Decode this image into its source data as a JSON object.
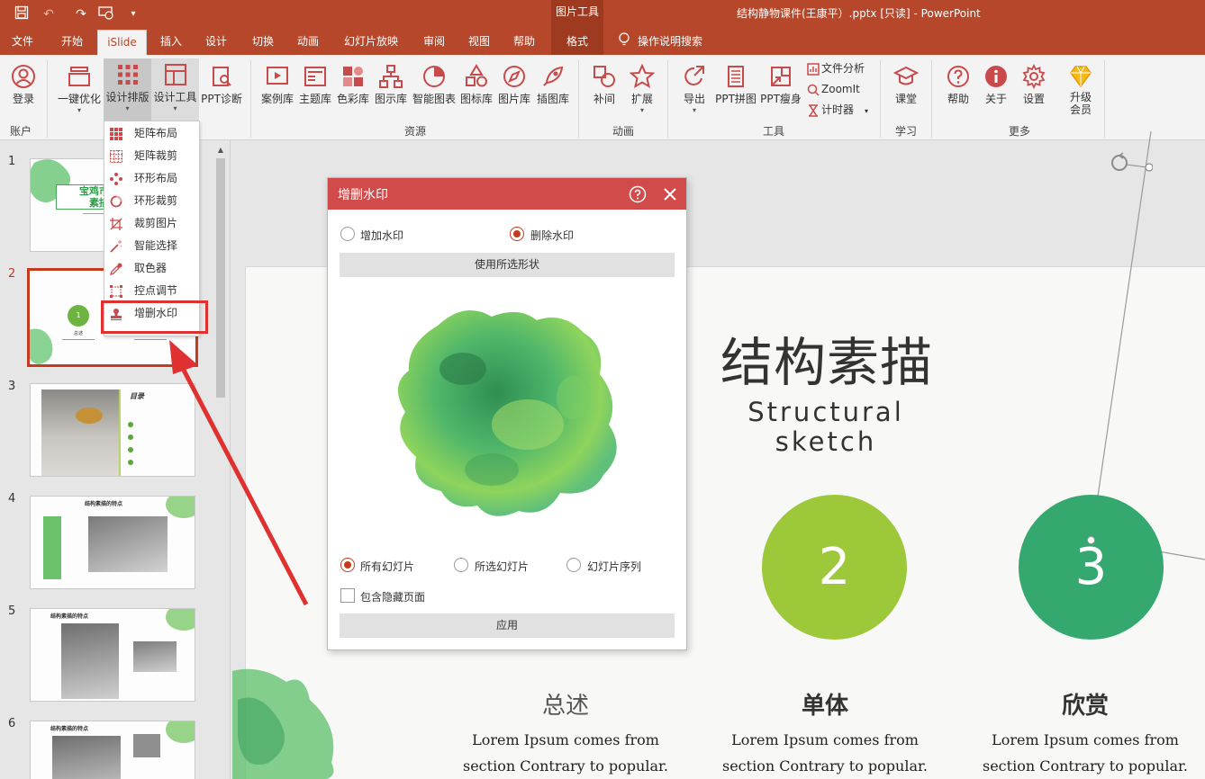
{
  "titlebar": {
    "context_tool_label": "图片工具",
    "window_title": "结构静物课件(王康平）.pptx [只读]  -  PowerPoint"
  },
  "tabs": [
    {
      "label": "文件"
    },
    {
      "label": "开始"
    },
    {
      "label": "iSlide"
    },
    {
      "label": "插入"
    },
    {
      "label": "设计"
    },
    {
      "label": "切换"
    },
    {
      "label": "动画"
    },
    {
      "label": "幻灯片放映"
    },
    {
      "label": "审阅"
    },
    {
      "label": "视图"
    },
    {
      "label": "帮助"
    },
    {
      "label": "格式"
    }
  ],
  "tell_me": "操作说明搜索",
  "ribbon": {
    "login": "登录",
    "optimize": "一键优化",
    "design_layout": "设计排版",
    "design_tools": "设计工具",
    "ppt_diagnose": "PPT诊断",
    "case_lib": "案例库",
    "theme_lib": "主题库",
    "color_lib": "色彩库",
    "diagram_lib": "图示库",
    "smart_chart": "智能图表",
    "icon_lib": "图标库",
    "image_lib": "图片库",
    "illustration_lib": "插图库",
    "tween": "补间",
    "extend": "扩展",
    "export": "导出",
    "ppt_puzzle": "PPT拼图",
    "ppt_slim": "PPT瘦身",
    "file_analysis": "文件分析",
    "zoomit": "ZoomIt",
    "timer": "计时器",
    "classroom": "课堂",
    "help": "帮助",
    "about": "关于",
    "settings": "设置",
    "upgrade": "升级会员",
    "groups": {
      "account": "账户",
      "resources": "资源",
      "animation": "动画",
      "tools": "工具",
      "learning": "学习",
      "more": "更多"
    }
  },
  "dropdown": {
    "items": [
      {
        "label": "矩阵布局"
      },
      {
        "label": "矩阵裁剪"
      },
      {
        "label": "环形布局"
      },
      {
        "label": "环形裁剪"
      },
      {
        "label": "裁剪图片"
      },
      {
        "label": "智能选择"
      },
      {
        "label": "取色器"
      },
      {
        "label": "控点调节"
      },
      {
        "label": "增删水印"
      }
    ]
  },
  "slides": [
    {
      "number": "1",
      "title": "宝鸡市教",
      "subtitle": "素描"
    },
    {
      "number": "2",
      "circle": "1",
      "caption": "总述"
    },
    {
      "number": "3",
      "heading": "目录"
    },
    {
      "number": "4",
      "heading": "结构素描的特点"
    },
    {
      "number": "5",
      "heading": "结构素描的特点"
    },
    {
      "number": "6",
      "heading": "结构素描的特点"
    }
  ],
  "dialog": {
    "title": "增删水印",
    "add_watermark": "增加水印",
    "remove_watermark": "删除水印",
    "mode": "remove",
    "use_shape_button": "使用所选形状",
    "scope_all": "所有幻灯片",
    "scope_selected": "所选幻灯片",
    "scope_sequence": "幻灯片序列",
    "scope": "all",
    "include_hidden": "包含隐藏页面",
    "include_hidden_checked": false,
    "apply_button": "应用"
  },
  "main_slide": {
    "title": "结构素描",
    "subtitle_line1": "Structural",
    "subtitle_line2": "sketch",
    "circles": [
      {
        "number": "2",
        "color": "#9cc83a"
      },
      {
        "number": "3",
        "color": "#34a86e"
      }
    ],
    "columns": [
      {
        "heading": "总述",
        "line1": "Lorem Ipsum comes from",
        "line2": "section Contrary to popular."
      },
      {
        "heading": "单体",
        "line1": "Lorem Ipsum comes from",
        "line2": "section Contrary to popular."
      },
      {
        "heading": "欣赏",
        "line1": "Lorem Ipsum comes from",
        "line2": "section Contrary to popular."
      }
    ]
  },
  "colors": {
    "accent": "#b7472a",
    "dialog_header": "#d24b4b",
    "annotation_arrow": "#e03131"
  }
}
